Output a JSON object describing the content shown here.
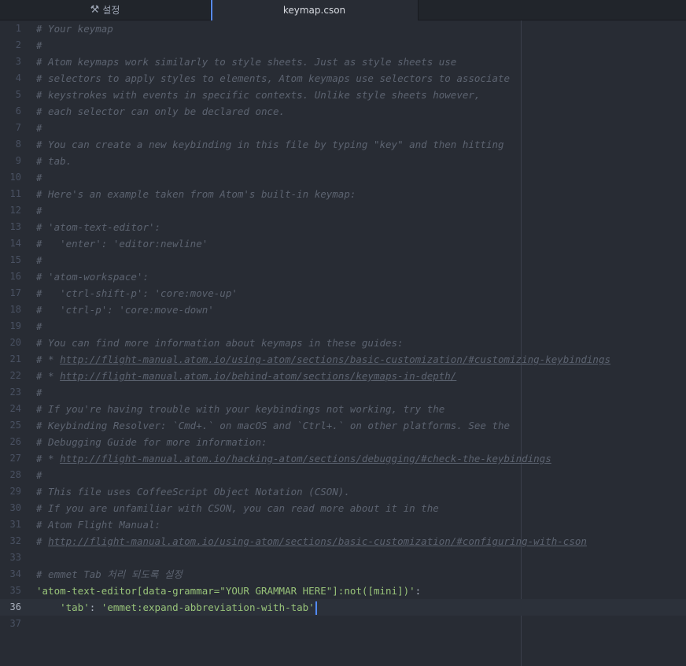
{
  "tabs": [
    {
      "label": "설정",
      "icon": "tools-icon",
      "active": false
    },
    {
      "label": "keymap.cson",
      "active": true
    }
  ],
  "editor": {
    "cursor_line": 36,
    "lines": [
      {
        "n": "1",
        "t": "# Your keymap"
      },
      {
        "n": "2",
        "t": "#"
      },
      {
        "n": "3",
        "t": "# Atom keymaps work similarly to style sheets. Just as style sheets use"
      },
      {
        "n": "4",
        "t": "# selectors to apply styles to elements, Atom keymaps use selectors to associate"
      },
      {
        "n": "5",
        "t": "# keystrokes with events in specific contexts. Unlike style sheets however,"
      },
      {
        "n": "6",
        "t": "# each selector can only be declared once."
      },
      {
        "n": "7",
        "t": "#"
      },
      {
        "n": "8",
        "t": "# You can create a new keybinding in this file by typing \"key\" and then hitting"
      },
      {
        "n": "9",
        "t": "# tab."
      },
      {
        "n": "10",
        "t": "#"
      },
      {
        "n": "11",
        "t": "# Here's an example taken from Atom's built-in keymap:"
      },
      {
        "n": "12",
        "t": "#"
      },
      {
        "n": "13",
        "t": "# 'atom-text-editor':"
      },
      {
        "n": "14",
        "t": "#   'enter': 'editor:newline'"
      },
      {
        "n": "15",
        "t": "#"
      },
      {
        "n": "16",
        "t": "# 'atom-workspace':"
      },
      {
        "n": "17",
        "t": "#   'ctrl-shift-p': 'core:move-up'"
      },
      {
        "n": "18",
        "t": "#   'ctrl-p': 'core:move-down'"
      },
      {
        "n": "19",
        "t": "#"
      },
      {
        "n": "20",
        "t": "# You can find more information about keymaps in these guides:"
      },
      {
        "n": "21",
        "t": "# * ",
        "u": "http://flight-manual.atom.io/using-atom/sections/basic-customization/#customizing-keybindings"
      },
      {
        "n": "22",
        "t": "# * ",
        "u": "http://flight-manual.atom.io/behind-atom/sections/keymaps-in-depth/"
      },
      {
        "n": "23",
        "t": "#"
      },
      {
        "n": "24",
        "t": "# If you're having trouble with your keybindings not working, try the"
      },
      {
        "n": "25",
        "t": "# Keybinding Resolver: `Cmd+.` on macOS and `Ctrl+.` on other platforms. See the"
      },
      {
        "n": "26",
        "t": "# Debugging Guide for more information:"
      },
      {
        "n": "27",
        "t": "# * ",
        "u": "http://flight-manual.atom.io/hacking-atom/sections/debugging/#check-the-keybindings"
      },
      {
        "n": "28",
        "t": "#"
      },
      {
        "n": "29",
        "t": "# This file uses CoffeeScript Object Notation (CSON)."
      },
      {
        "n": "30",
        "t": "# If you are unfamiliar with CSON, you can read more about it in the"
      },
      {
        "n": "31",
        "t": "# Atom Flight Manual:"
      },
      {
        "n": "32",
        "t": "# ",
        "u": "http://flight-manual.atom.io/using-atom/sections/basic-customization/#configuring-with-cson"
      },
      {
        "n": "33",
        "t": ""
      },
      {
        "n": "34",
        "t": "# emmet Tab 처리 되도록 설정"
      },
      {
        "n": "35",
        "s": "'atom-text-editor[data-grammar=\"YOUR GRAMMAR HERE\"]:not([mini])'",
        "p": ":"
      },
      {
        "n": "36",
        "ind": "    ",
        "s": "'tab'",
        "p": ": ",
        "s2": "'emmet:expand-abbreviation-with-tab'"
      },
      {
        "n": "37",
        "t": ""
      }
    ]
  }
}
